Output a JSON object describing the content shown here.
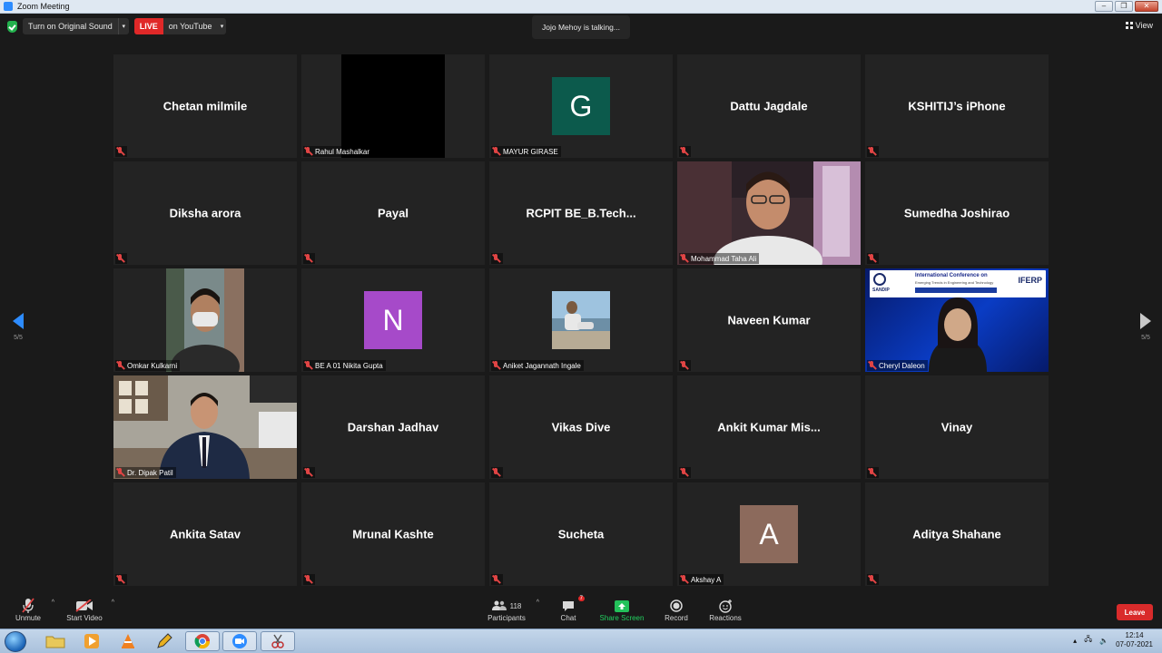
{
  "window": {
    "title": "Zoom Meeting"
  },
  "topbar": {
    "original_sound": "Turn on Original Sound",
    "live_label": "LIVE",
    "live_destination": "on YouTube",
    "talking": "Jojo Mehoy is talking...",
    "view": "View"
  },
  "paging": {
    "left": "5/5",
    "right": "5/5"
  },
  "tiles": [
    {
      "name": "Chetan milmile"
    },
    {
      "label": "Rahul Mashalkar"
    },
    {
      "initial": "G",
      "initial_color": "#0c5a4c",
      "label": "MAYUR GIRASE"
    },
    {
      "name": "Dattu Jagdale"
    },
    {
      "name": "KSHITIJ’s iPhone"
    },
    {
      "name": "Diksha arora"
    },
    {
      "name": "Payal"
    },
    {
      "name": "RCPIT  BE_B.Tech..."
    },
    {
      "label": "Mohammad Taha Ali"
    },
    {
      "name": "Sumedha Joshirao"
    },
    {
      "label": "Omkar Kulkarni"
    },
    {
      "initial": "N",
      "initial_color": "#a64ac9",
      "label": "BE A 01 Nikita Gupta"
    },
    {
      "label": "Aniket Jagannath Ingale"
    },
    {
      "name": "Naveen Kumar"
    },
    {
      "label": "Cheryl Daleon",
      "banner_title": "International Conference on",
      "banner_sub": "Emerging Trends in Engineering and Technology",
      "banner_logo": "IFERP",
      "banner_left": "SANDIP"
    },
    {
      "label": "Dr. Dipak Patil"
    },
    {
      "name": "Darshan Jadhav"
    },
    {
      "name": "Vikas Dive"
    },
    {
      "name": "Ankit  Kumar  Mis..."
    },
    {
      "name": "Vinay"
    },
    {
      "name": "Ankita Satav"
    },
    {
      "name": "Mrunal Kashte"
    },
    {
      "name": "Sucheta"
    },
    {
      "initial": "A",
      "initial_color": "#8c6a5c",
      "label": "Akshay A"
    },
    {
      "name": "Aditya Shahane"
    }
  ],
  "toolbar": {
    "unmute": "Unmute",
    "start_video": "Start Video",
    "participants_count": "118",
    "participants": "Participants",
    "chat": "Chat",
    "chat_badge": "7",
    "share": "Share Screen",
    "record": "Record",
    "reactions": "Reactions",
    "leave": "Leave"
  },
  "taskbar": {
    "time": "12:14",
    "date": "07-07-2021"
  }
}
